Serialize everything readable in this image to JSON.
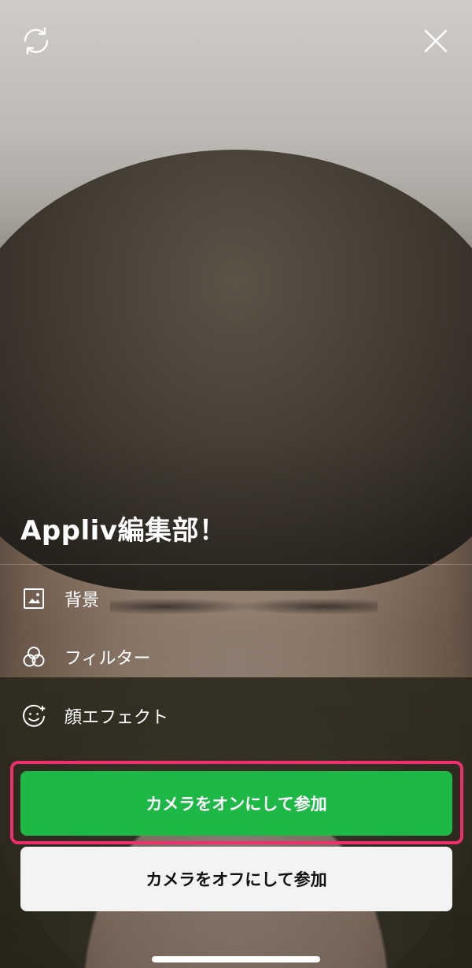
{
  "header": {
    "switch_camera_icon": "camera-switch-icon",
    "close_icon": "close-icon"
  },
  "group": {
    "title": "Appliv編集部！"
  },
  "menu": {
    "items": [
      {
        "label": "背景",
        "icon": "image-icon"
      },
      {
        "label": "フィルター",
        "icon": "filter-icon"
      },
      {
        "label": "顔エフェクト",
        "icon": "face-effect-icon"
      }
    ]
  },
  "actions": {
    "join_camera_on": "カメラをオンにして参加",
    "join_camera_off": "カメラをオフにして参加"
  },
  "colors": {
    "primary_button": "#1db846",
    "highlight_frame": "#ef2f6e",
    "secondary_button": "#f3f3f3"
  }
}
